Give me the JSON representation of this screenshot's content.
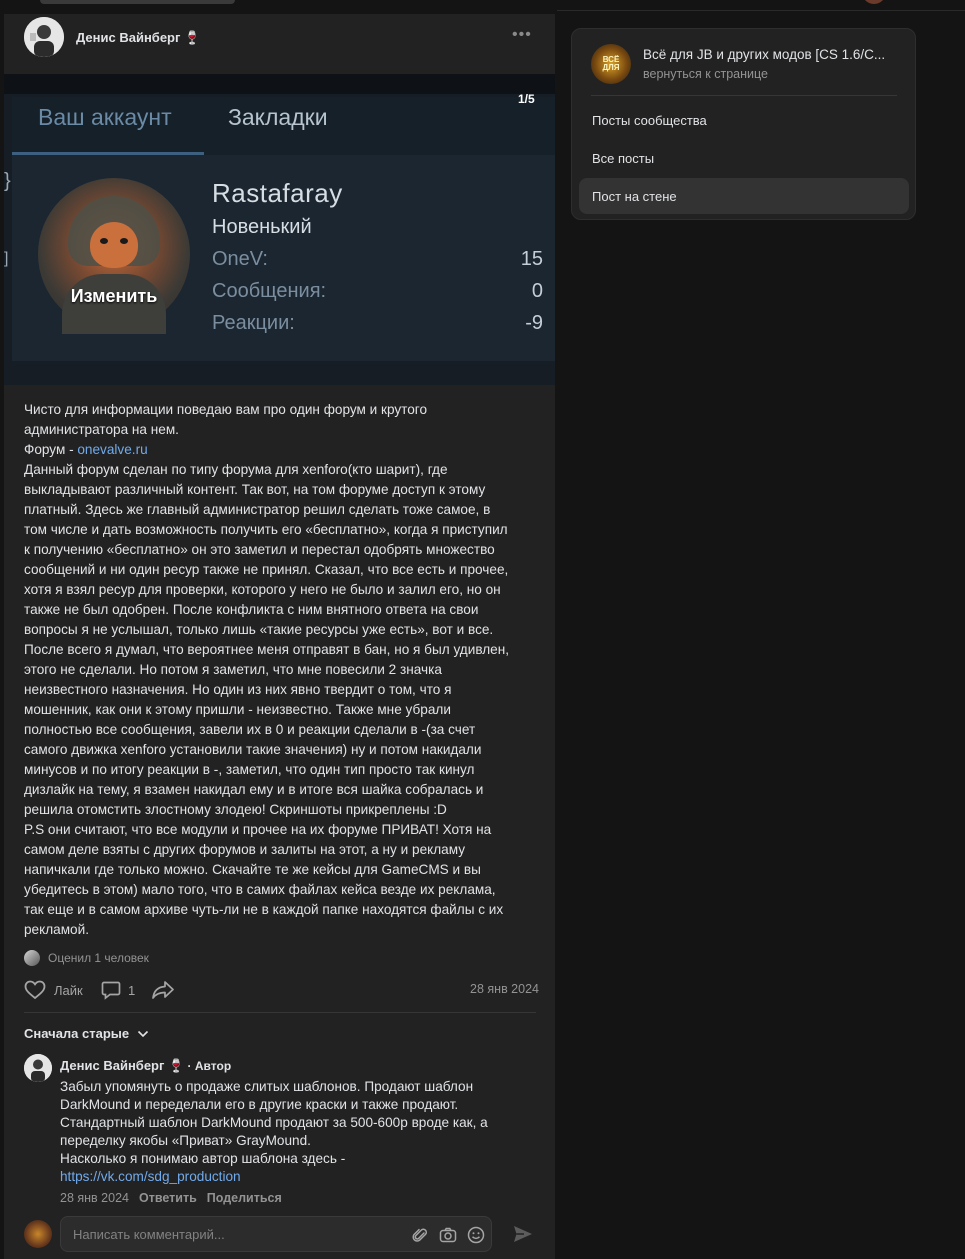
{
  "post": {
    "author": "Денис Вайнберг 🍷",
    "more": "•••",
    "image": {
      "counter": "1/5",
      "tab_account": "Ваш аккаунт",
      "tab_bookmarks": "Закладки",
      "avatar_overlay": "Изменить",
      "username": "Rastafaray",
      "rank": "Новенький",
      "stats": [
        {
          "label": "OneV:",
          "value": "15"
        },
        {
          "label": "Сообщения:",
          "value": "0"
        },
        {
          "label": "Реакции:",
          "value": "-9"
        }
      ],
      "edge_marks": [
        "}",
        "]"
      ]
    },
    "text": {
      "line1": "Чисто для информации поведаю вам про один форум и крутого",
      "line2": "администратора на нем.",
      "forum_prefix": "Форум - ",
      "forum_link": "onevalve.ru",
      "lines": [
        "Данный форум сделан по типу форума для xenforo(кто шарит), где",
        "выкладывают различный контент. Так вот, на том форуме доступ к этому",
        "платный. Здесь же главный администратор решил сделать тоже самое, в",
        "том числе и дать возможность получить его «бесплатно», когда я приступил",
        "к получению «бесплатно» он это заметил и перестал одобрять множество",
        "сообщений и ни один ресур также не принял. Сказал, что все есть и прочее,",
        "хотя я взял ресур для проверки, которого у него не было и залил его, но он",
        "также не был одобрен. После конфликта с ним внятного ответа на свои",
        "вопросы я не услышал, только лишь «такие ресурсы уже есть», вот и все.",
        "После всего я думал, что вероятнее меня отправят в бан, но я был удивлен,",
        "этого не сделали. Но потом я заметил, что мне повесили 2 значка",
        "неизвестного назначения. Но один из них явно твердит о том, что я",
        "мошенник, как они к этому пришли - неизвестно. Также мне убрали",
        "полностью все сообщения, завели их в 0 и реакции сделали в -(за счет",
        "самого движка xenforo установили такие значения) ну и потом накидали",
        "минусов и по итогу реакции в -, заметил, что один тип просто так кинул",
        "дизлайк на тему, я взамен накидал ему и в итоге вся шайка собралась и",
        "решила отомстить злостному злодею! Скриншоты прикреплены :D",
        "P.S они считают, что все модули и прочее на их форуме ПРИВАТ! Хотя на",
        "самом деле взяты с других форумов и залиты на этот, а ну и рекламу",
        "напичкали где только можно. Скачайте те же кейсы для GameCMS и вы",
        "убедитесь в этом) мало того, что в самих файлах кейса везде их реклама,",
        "так еще и в самом архиве чуть-ли не в каждой папке находятся файлы с их",
        "рекламой."
      ]
    },
    "liked_by": "Оценил 1 человек",
    "actions": {
      "like_label": "Лайк",
      "comment_count": "1",
      "date": "28 янв 2024"
    },
    "sort_label": "Сначала старые",
    "comment": {
      "author": "Денис Вайнберг 🍷",
      "badge": " · Автор",
      "lines": [
        "Забыл упомянуть о продаже слитых шаблонов. Продают шаблон",
        "DarkMound и переделали его в другие краски и также продают.",
        "Стандартный шаблон DarkMound продают за 500-600р вроде как, а",
        "переделку якобы «Приват» GrayMound.",
        "Насколько я понимаю автор шаблона здесь -"
      ],
      "link": "https://vk.com/sdg_production",
      "date": "28 янв 2024",
      "reply": "Ответить",
      "share": "Поделиться"
    },
    "composer_placeholder": "Написать комментарий..."
  },
  "sidebar": {
    "club_logo_text": "ВСЁ ДЛЯ",
    "club_name": "Всё для JB и других модов [CS 1.6/C...",
    "back_link": "вернуться к странице",
    "items": [
      {
        "label": "Посты сообщества"
      },
      {
        "label": "Все посты"
      },
      {
        "label": "Пост на стене"
      }
    ],
    "active_index": 2
  },
  "colors": {
    "background": "#141414",
    "card": "#222222",
    "link": "#71aaeb",
    "muted": "#939393"
  }
}
